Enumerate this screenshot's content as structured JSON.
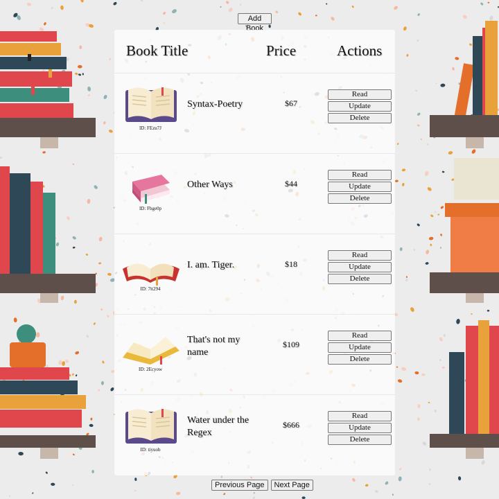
{
  "toolbar": {
    "add_book_label": "Add Book"
  },
  "table": {
    "headers": {
      "title": "Book Title",
      "price": "Price",
      "actions": "Actions"
    },
    "action_labels": {
      "read": "Read",
      "update": "Update",
      "delete": "Delete"
    },
    "rows": [
      {
        "cover": "open-book-icon",
        "id_label": "ID: FEzu7J",
        "title": "Syntax-Poetry",
        "price": "$67"
      },
      {
        "cover": "closed-pink-book-icon",
        "id_label": "ID: Fbge0p",
        "title": "Other Ways",
        "price": "$44"
      },
      {
        "cover": "open-red-book-icon",
        "id_label": "ID: 7tt294",
        "title": "I. am. Tiger.",
        "price": "$18"
      },
      {
        "cover": "open-yellow-book-icon",
        "id_label": "ID: 2Ecyow",
        "title": "That's not my name",
        "price": "$109"
      },
      {
        "cover": "open-book-icon",
        "id_label": "ID: tiyuob",
        "title": "Water under the Regex",
        "price": "$666"
      }
    ]
  },
  "pagination": {
    "prev_label": "Previous Page",
    "next_label": "Next Page"
  },
  "colors": {
    "panel": "#fcfcfc",
    "background": "#ececec",
    "button": "#efefef"
  }
}
